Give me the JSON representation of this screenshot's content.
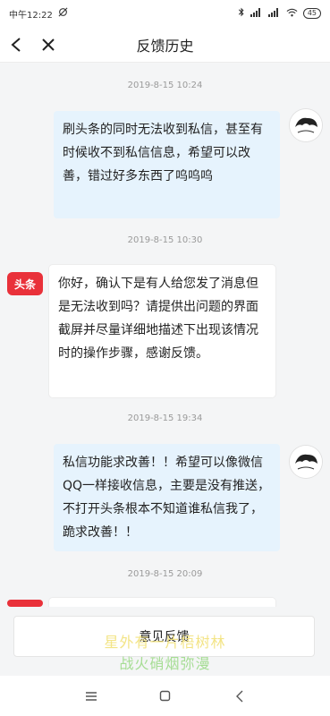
{
  "status_bar": {
    "time": "中午12:22",
    "battery": "45"
  },
  "nav": {
    "title": "反馈历史"
  },
  "messages": [
    {
      "timestamp": "2019-8-15 10:24",
      "sender": "user",
      "text": "刷头条的同时无法收到私信，甚至有时候收不到私信信息，希望可以改善，错过好多东西了呜呜呜"
    },
    {
      "timestamp": "2019-8-15 10:30",
      "sender": "bot",
      "text": "你好，确认下是有人给您发了消息但是无法收到吗？请提供出问题的界面截屏并尽量详细地描述下出现该情况时的操作步骤，感谢反馈。"
    },
    {
      "timestamp": "2019-8-15 19:34",
      "sender": "user",
      "text": "私信功能求改善！！希望可以像微信 QQ一样接收信息，主要是没有推送，不打开头条根本不知道谁私信我了，跪求改善！！"
    },
    {
      "timestamp": "2019-8-15 20:09",
      "sender": "bot",
      "text": ""
    }
  ],
  "bot_avatar_label": "头条",
  "feedback_button": "意见反馈",
  "watermark": {
    "line1": "星外有一片梧树林",
    "line2": "战火硝烟弥漫"
  },
  "colors": {
    "user_bubble": "#e6f3fd",
    "bot_brand": "#e9313a"
  }
}
